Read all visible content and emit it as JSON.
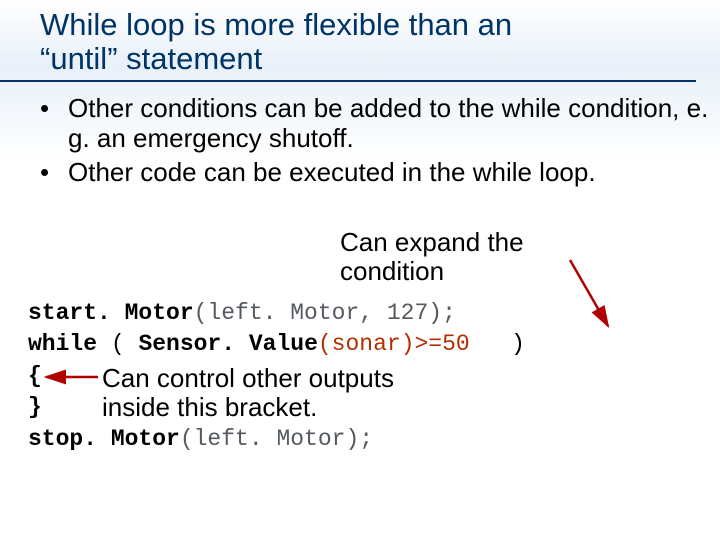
{
  "title_line1": "While loop is more flexible than an",
  "title_line2": "“until” statement",
  "bullets": [
    "Other conditions can be added to the while condition, e. g. an emergency shutoff.",
    "Other code can be executed in the while loop."
  ],
  "expand_label_l1": "Can expand the",
  "expand_label_l2": "condition",
  "code": {
    "start_kw": "start. Motor",
    "start_args": "(left. Motor, 127);",
    "while_kw": "while",
    "while_open": " ( ",
    "sensor_kw": "Sensor. Value",
    "sensor_args": "(sonar)>=50",
    "while_close": "   )",
    "brace_open": "{",
    "brace_close": "}",
    "stop_kw": "stop. Motor",
    "stop_args": "(left. Motor);"
  },
  "control_label_l1": "Can control other outputs",
  "control_label_l2": "inside this bracket."
}
